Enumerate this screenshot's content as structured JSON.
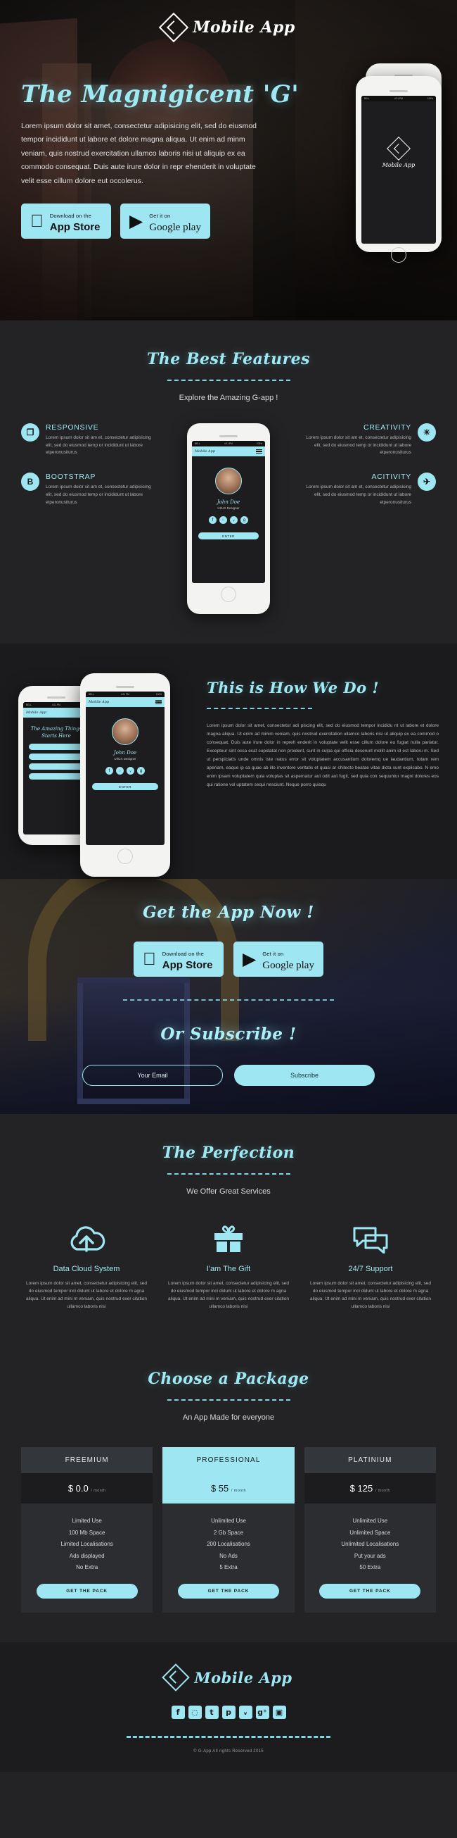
{
  "brand": {
    "name": "Mobile App"
  },
  "hero": {
    "title": "The Magnigicent 'G'",
    "paragraph": "Lorem ipsum dolor sit amet, consectetur adipisicing elit, sed do eiusmod tempor incididunt ut labore et dolore magna aliqua. Ut enim ad minm veniam, quis nostrud exercitation ullamco laboris nisi ut aliquip ex ea commodo consequat. Duis aute irure dolor in repr ehenderit in voluptate velit esse cillum dolore eut occolerus.",
    "appstore": {
      "small": "Download on the",
      "big": "App Store",
      "icon": "apple-icon"
    },
    "googleplay": {
      "small": "Get it on",
      "big": "Google play",
      "icon": "play-triangle-icon"
    },
    "phone_back": {
      "title_line1": "The Amazing Things",
      "title_line2": "Starts Here"
    },
    "status_bar": {
      "carrier": "BELL",
      "time": "4:21 PM",
      "battery": "100%"
    }
  },
  "features": {
    "title": "The Best Features",
    "subtitle": "Explore the Amazing G-app !",
    "left": [
      {
        "icon_glyph": "❐",
        "icon_name": "layers-icon",
        "title": "RESPONSIVE",
        "text": "Lorem ipsum dolor sit am et, consectetur adipisicing elit, sed do eiusmod temp or incididunt ut labore etperonusiturus"
      },
      {
        "icon_glyph": "B",
        "icon_name": "bootstrap-icon",
        "title": "BOOTSTRAP",
        "text": "Lorem ipsum dolor sit am et, consectetur adipisicing elit, sed do eiusmod temp or incididunt ut labore etperonusiturus"
      }
    ],
    "right": [
      {
        "icon_glyph": "☀",
        "icon_name": "lightbulb-icon",
        "title": "CREATIVITY",
        "text": "Lorem ipsum dolor sit am et, consectetur adipisicing elit, sed do eiusmod temp or incididunt ut labore etperonusiturus"
      },
      {
        "icon_glyph": "✈",
        "icon_name": "rocket-icon",
        "title": "ACITIVITY",
        "text": "Lorem ipsum dolor sit am et, consectetur adipisicing elit, sed do eiusmod temp or incididunt ut labore etperonusiturus"
      }
    ],
    "phone_profile": {
      "name": "John Doe",
      "role": "UI/UX Designer",
      "button": "ENTER"
    }
  },
  "how": {
    "title": "This is How We Do !",
    "text": "Lorem ipsum dolor sit amet, consectetur adi piscing elit, sed do eiusmod tempor incididu nt ut labore et dolore magna aliqua. Ut enim ad minim veniam, quis nostrud exercitation ullamco laboris nisi ut aliquip ex ea commod o consequat. Duis aute irure dolor in repreh enderit in voluptate velit esse cillum dolore eu fugiat nulla pariatur. Excepteur sint occa ecat cupidatat non proident, sunt in culpa qui officia deserunt mollit anim id est laboru m. Sed ut perspiciatis unde omnis iste natus error sit voluptatem accusantium doloremq ue laudantium, totam rem aperiam, eaque ip sa quae ab illo inventore veritatis et quasi ar chitecto beatae vitae dicta sunt explicabo. N emo enim ipsam voluptatem quia voluptas sit aspernatur aut odit aut fugit, sed quia con sequuntur magni dolores eos qui ratione vol uptatem sequi nesciunt. Neque porro quisqu"
  },
  "cta": {
    "title": "Get the App Now !",
    "appstore": {
      "small": "Download on the",
      "big": "App Store"
    },
    "googleplay": {
      "small": "Get it on",
      "big": "Google play"
    },
    "subscribe_title": "Or Subscribe !",
    "email_placeholder": "Your Email",
    "subscribe_button": "Subscribe"
  },
  "services": {
    "title": "The Perfection",
    "subtitle": "We Offer Great Services",
    "items": [
      {
        "icon_name": "cloud-upload-icon",
        "title": "Data Cloud System",
        "text": "Lorem ipsum dolor sit amet, consectetur adipisicing elit, sed do eiusmod tempor inci didunt ut labore et dolore m agna aliqua. Ut enim ad mini m veniam, quis nostrud exer citation ullamco laboris nisi"
      },
      {
        "icon_name": "gift-icon",
        "title": "I'am The Gift",
        "text": "Lorem ipsum dolor sit amet, consectetur adipisicing elit, sed do eiusmod tempor inci didunt ut labore et dolore m agna aliqua. Ut enim ad mini m veniam, quis nostrud exer citation ullamco laboris nisi"
      },
      {
        "icon_name": "chat-bubbles-icon",
        "title": "24/7 Support",
        "text": "Lorem ipsum dolor sit amet, consectetur adipisicing elit, sed do eiusmod tempor inci didunt ut labore et dolore m agna aliqua. Ut enim ad mini m veniam, quis nostrud exer citation ullamco laboris nisi"
      }
    ]
  },
  "pricing": {
    "title": "Choose a Package",
    "subtitle": "An App Made for everyone",
    "plans": [
      {
        "name": "FREEMIUM",
        "price": "$ 0.0",
        "per": "/ month",
        "highlighted": false,
        "features": [
          "Limited Use",
          "100 Mb Space",
          "Limited Localisations",
          "Ads displayed",
          "No Extra"
        ],
        "button": "GET THE PACK"
      },
      {
        "name": "PROFESSIONAL",
        "price": "$ 55",
        "per": "/ month",
        "highlighted": true,
        "features": [
          "Unlimited Use",
          "2 Gb Space",
          "200 Localisations",
          "No Ads",
          "5 Extra"
        ],
        "button": "GET THE PACK"
      },
      {
        "name": "PLATINIUM",
        "price": "$ 125",
        "per": "/ month",
        "highlighted": false,
        "features": [
          "Unlimited Use",
          "Unlimited Space",
          "Unlimited Localisations",
          "Put your ads",
          "50 Extra"
        ],
        "button": "GET THE PACK"
      }
    ]
  },
  "footer": {
    "brand": "Mobile App",
    "social": [
      {
        "name": "facebook-icon",
        "glyph": "f"
      },
      {
        "name": "dribbble-icon",
        "glyph": "◌"
      },
      {
        "name": "tumblr-icon",
        "glyph": "t"
      },
      {
        "name": "pinterest-icon",
        "glyph": "р"
      },
      {
        "name": "twitter-icon",
        "glyph": "ᵥ"
      },
      {
        "name": "google-plus-icon",
        "glyph": "g⁺"
      },
      {
        "name": "instagram-icon",
        "glyph": "▣"
      }
    ],
    "copyright": "© G-App All rights Reserved 2015"
  }
}
